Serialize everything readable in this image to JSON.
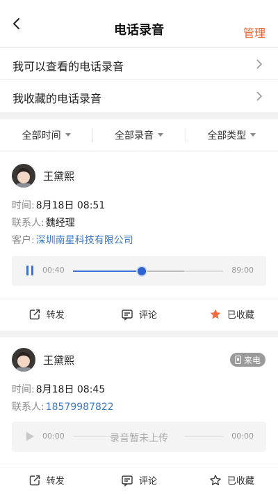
{
  "header": {
    "title": "电话录音",
    "manage_label": "管理"
  },
  "links": [
    {
      "label": "我可以查看的电话录音"
    },
    {
      "label": "我收藏的电话录音"
    }
  ],
  "filters": [
    {
      "label": "全部时间"
    },
    {
      "label": "全部录音"
    },
    {
      "label": "全部类型"
    }
  ],
  "records": [
    {
      "user": "王黛熙",
      "time_label": "时间:",
      "time": "8月18日 08:51",
      "contact_label": "联系人:",
      "contact": "魏经理",
      "customer_label": "客户:",
      "customer": "深圳南星科技有限公司",
      "player": {
        "current": "00:40",
        "total": "89:00",
        "progress": 0.46,
        "buffered": 0.74
      },
      "actions": {
        "forward": "转发",
        "comment": "评论",
        "favorite": "已收藏"
      }
    },
    {
      "user": "王黛熙",
      "badge": "来电",
      "time_label": "时间:",
      "time": "8月18日 08:45",
      "contact_label": "联系人:",
      "contact": "18579987822",
      "player": {
        "current": "00:00",
        "total": "00:00",
        "status": "录音暂未上传"
      },
      "actions": {
        "forward": "转发",
        "comment": "评论",
        "favorite": "已收藏"
      }
    }
  ],
  "colors": {
    "accent": "#f05a28",
    "link": "#3c78c3",
    "progress": "#3d6fd6",
    "star": "#f26d3d"
  }
}
